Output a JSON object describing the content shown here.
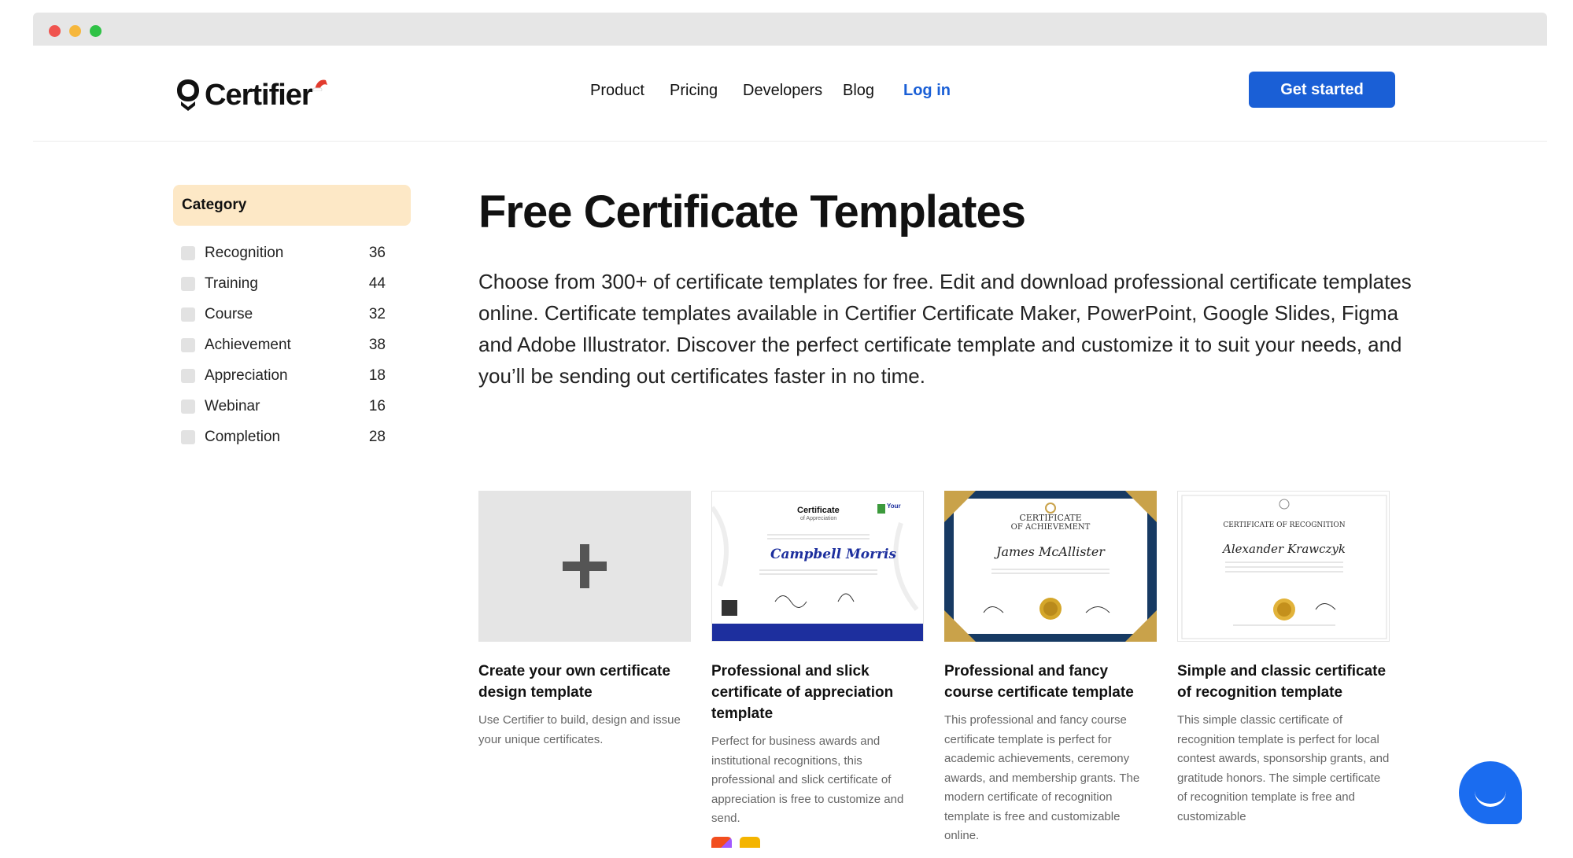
{
  "brand": {
    "name": "Certifier",
    "accent": "#1a5fd6",
    "category_bg": "#fde8c6"
  },
  "nav": {
    "items": [
      "Product",
      "Pricing",
      "Developers",
      "Blog"
    ],
    "login": "Log in",
    "cta": "Get started"
  },
  "sidebar": {
    "heading": "Category",
    "categories": [
      {
        "label": "Recognition",
        "count": "36"
      },
      {
        "label": "Training",
        "count": "44"
      },
      {
        "label": "Course",
        "count": "32"
      },
      {
        "label": "Achievement",
        "count": "38"
      },
      {
        "label": "Appreciation",
        "count": "18"
      },
      {
        "label": "Webinar",
        "count": "16"
      },
      {
        "label": "Completion",
        "count": "28"
      }
    ]
  },
  "main": {
    "title": "Free Certificate Templates",
    "description": "Choose from 300+ of certificate templates for free. Edit and download professional certificate templates online. Certificate templates available in Certifier Certificate Maker, PowerPoint, Google Slides, Figma and Adobe Illustrator. Discover the perfect certificate template and customize it to suit your needs, and you’ll be sending out certificates faster in no time."
  },
  "cards": [
    {
      "title": "Create your own certificate design template",
      "desc": "Use Certifier to build, design and issue your unique certificates."
    },
    {
      "title": "Professional and slick certificate of appreciation template",
      "desc": "Perfect for business awards and institutional recognitions, this professional and slick certificate of appreciation is free to customize and send.",
      "thumb": {
        "heading": "Certificate",
        "sub": "of Appreciation",
        "name": "Campbell Morris",
        "logo": "Your"
      }
    },
    {
      "title": "Professional and fancy course certificate template",
      "desc": "This professional and fancy course certificate template is perfect for academic achievements, ceremony awards, and membership grants. The modern certificate of recognition template is free and customizable online.",
      "thumb": {
        "heading": "CERTIFICATE",
        "sub": "OF ACHIEVEMENT",
        "name": "James McAllister"
      }
    },
    {
      "title": "Simple and classic certificate of recognition template",
      "desc": "This simple classic certificate of recognition template is perfect for local contest awards, sponsorship grants, and gratitude honors. The simple certificate of recognition template is free and customizable",
      "thumb": {
        "heading": "CERTIFICATE OF RECOGNITION",
        "name": "Alexander Krawczyk"
      }
    }
  ]
}
